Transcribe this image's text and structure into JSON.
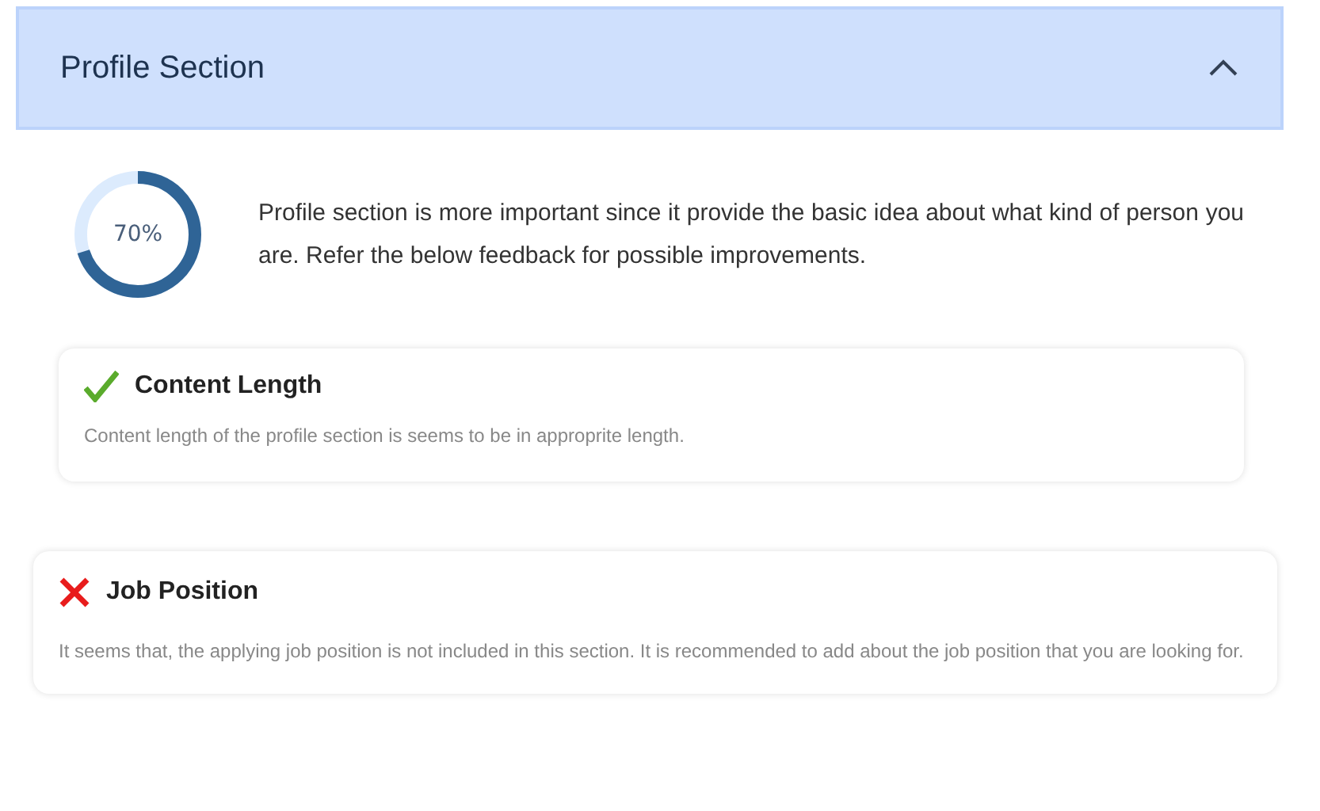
{
  "section": {
    "title": "Profile Section",
    "expanded": true
  },
  "score": {
    "label": "70%",
    "level": 0.7
  },
  "summary": "Profile section is more important since it provide the basic idea about what kind of person you are. Refer the below feedback for possible improvements.",
  "feedback": [
    {
      "title": "Content Length",
      "passed": true,
      "text": "Content length of the profile section is seems to be in approprite length."
    },
    {
      "title": "Job Position",
      "passed": false,
      "text": "It seems that, the applying job position is not included in this section. It is recommended to add about the job position that you are looking for."
    }
  ]
}
